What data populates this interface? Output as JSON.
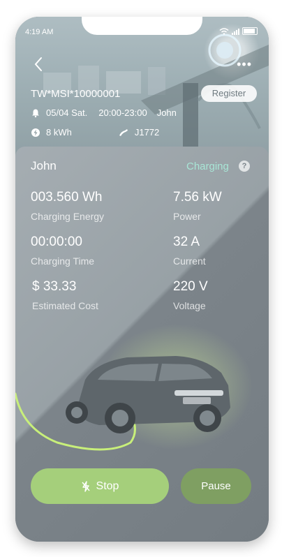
{
  "status_bar": {
    "time": "4:19 AM"
  },
  "header": {
    "station_id": "TW*MSI*10000001",
    "register_label": "Register",
    "date": "05/04 Sat.",
    "time_range": "20:00-23:00",
    "reserved_by": "John",
    "capacity": "8 kWh",
    "connector": "J1772"
  },
  "session": {
    "user": "John",
    "status": "Charging",
    "help_symbol": "?"
  },
  "metrics": {
    "energy_value": "003.560 Wh",
    "energy_label": "Charging Energy",
    "power_value": "7.56 kW",
    "power_label": "Power",
    "time_value": "00:00:00",
    "time_label": "Charging Time",
    "current_value": "32 A",
    "current_label": "Current",
    "cost_value": "$ 33.33",
    "cost_label": "Estimated Cost",
    "voltage_value": "220 V",
    "voltage_label": "Voltage"
  },
  "actions": {
    "stop_label": "Stop",
    "pause_label": "Pause"
  },
  "colors": {
    "status_color": "#a8e6d6",
    "stop_bg": "#a5cf7b",
    "pause_bg": "#7f9f62",
    "cable_glow": "#c8ef7a"
  }
}
